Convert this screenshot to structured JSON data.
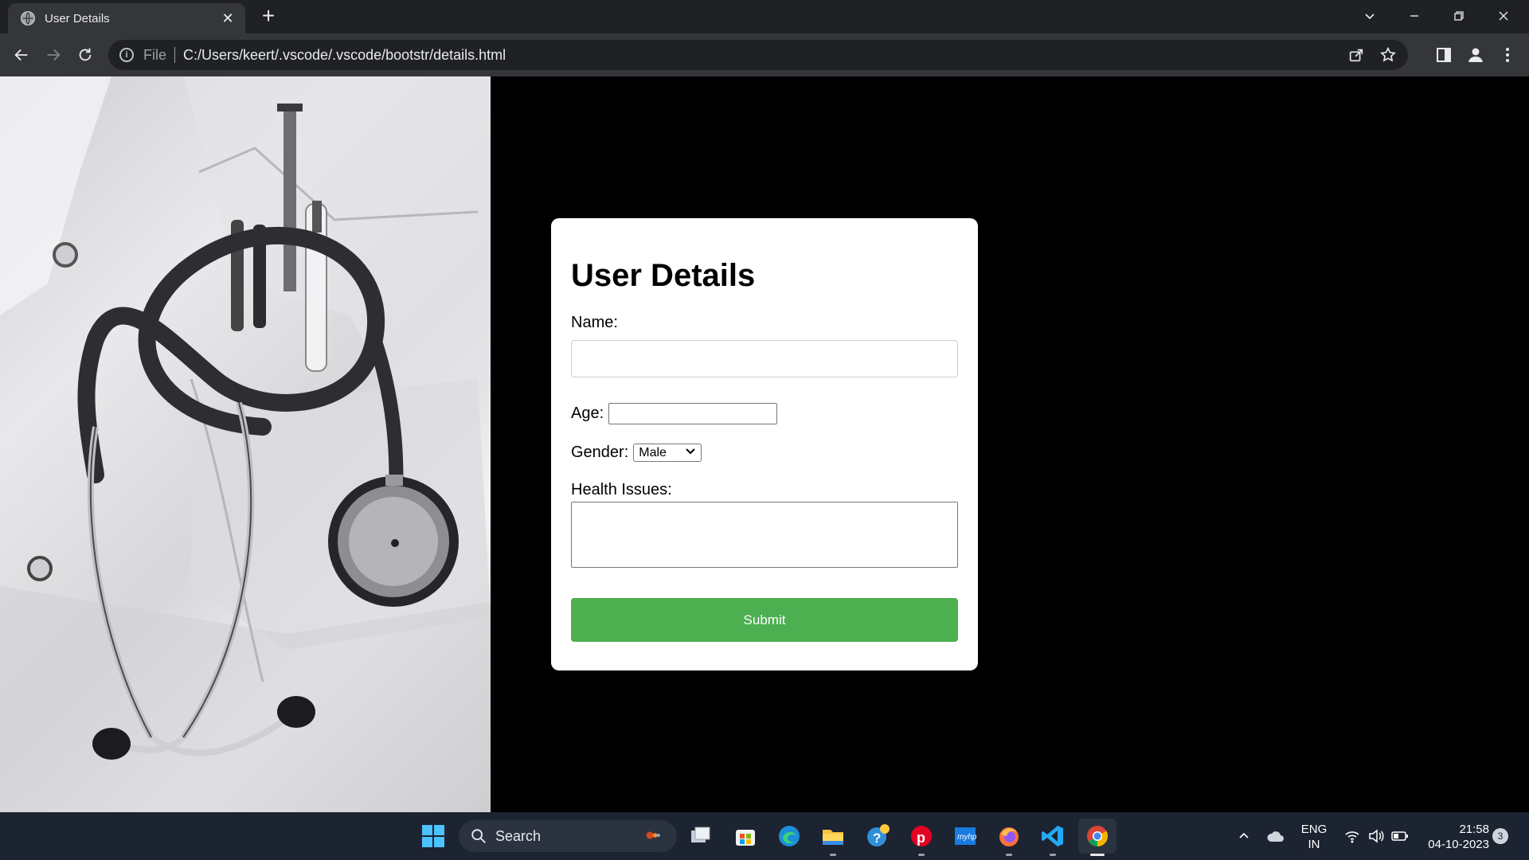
{
  "browser": {
    "tab_title": "User Details",
    "tab_close": "✕",
    "new_tab": "+",
    "url_scheme": "File",
    "url": "C:/Users/keert/.vscode/.vscode/bootstr/details.html"
  },
  "form": {
    "title": "User Details",
    "name_label": "Name:",
    "name_value": "",
    "age_label": "Age:",
    "age_value": "",
    "gender_label": "Gender:",
    "gender_selected": "Male",
    "health_label": "Health Issues:",
    "health_value": "",
    "submit_label": "Submit"
  },
  "taskbar": {
    "search_placeholder": "Search",
    "language_line1": "ENG",
    "language_line2": "IN",
    "time": "21:58",
    "date": "04-10-2023",
    "notification_count": "3"
  },
  "colors": {
    "page_background": "#000000",
    "card_background": "#ffffff",
    "submit_green": "#4caf50",
    "chrome_dark": "#202124",
    "taskbar": "#1c2331"
  }
}
